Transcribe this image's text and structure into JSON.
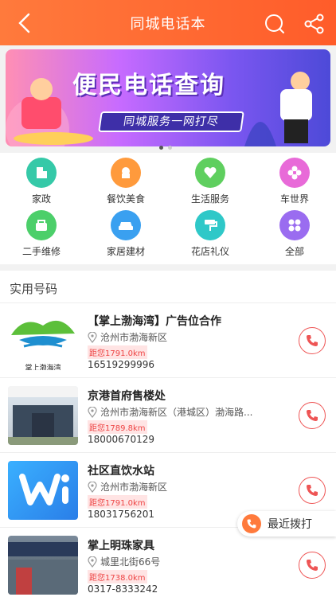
{
  "header": {
    "title": "同城电话本"
  },
  "banner": {
    "headline": "便民电话查询",
    "tagline": "同城服务一网打尽"
  },
  "categories": [
    {
      "label": "家政",
      "icon": "building-icon",
      "color": "#35c9a8"
    },
    {
      "label": "餐饮美食",
      "icon": "cake-icon",
      "color": "#ff9a3c"
    },
    {
      "label": "生活服务",
      "icon": "heart-icon",
      "color": "#5fcf5f"
    },
    {
      "label": "车世界",
      "icon": "flower-icon",
      "color": "#e86ad8"
    },
    {
      "label": "二手维修",
      "icon": "basket-icon",
      "color": "#4ccf6a"
    },
    {
      "label": "家居建材",
      "icon": "car-icon",
      "color": "#3aa0f0"
    },
    {
      "label": "花店礼仪",
      "icon": "roller-icon",
      "color": "#2fc8c8"
    },
    {
      "label": "全部",
      "icon": "grid-icon",
      "color": "#9a6cf0"
    }
  ],
  "section": {
    "title": "实用号码"
  },
  "listings": [
    {
      "name": "【掌上渤海湾】广告位合作",
      "address": "沧州市渤海新区",
      "distance": "距您1791.0km",
      "phone": "16519299996",
      "logo_text": "掌上渤海湾"
    },
    {
      "name": "京港首府售楼处",
      "address": "沧州市渤海新区（港城区）渤海路...",
      "distance": "距您1789.8km",
      "phone": "18000670129"
    },
    {
      "name": "社区直饮水站",
      "address": "沧州市渤海新区",
      "distance": "距您1791.0km",
      "phone": "18031756201"
    },
    {
      "name": "掌上明珠家具",
      "address": "城里北街66号",
      "distance": "距您1738.0km",
      "phone": "0317-8333242"
    }
  ],
  "recent": {
    "label": "最近拨打"
  }
}
